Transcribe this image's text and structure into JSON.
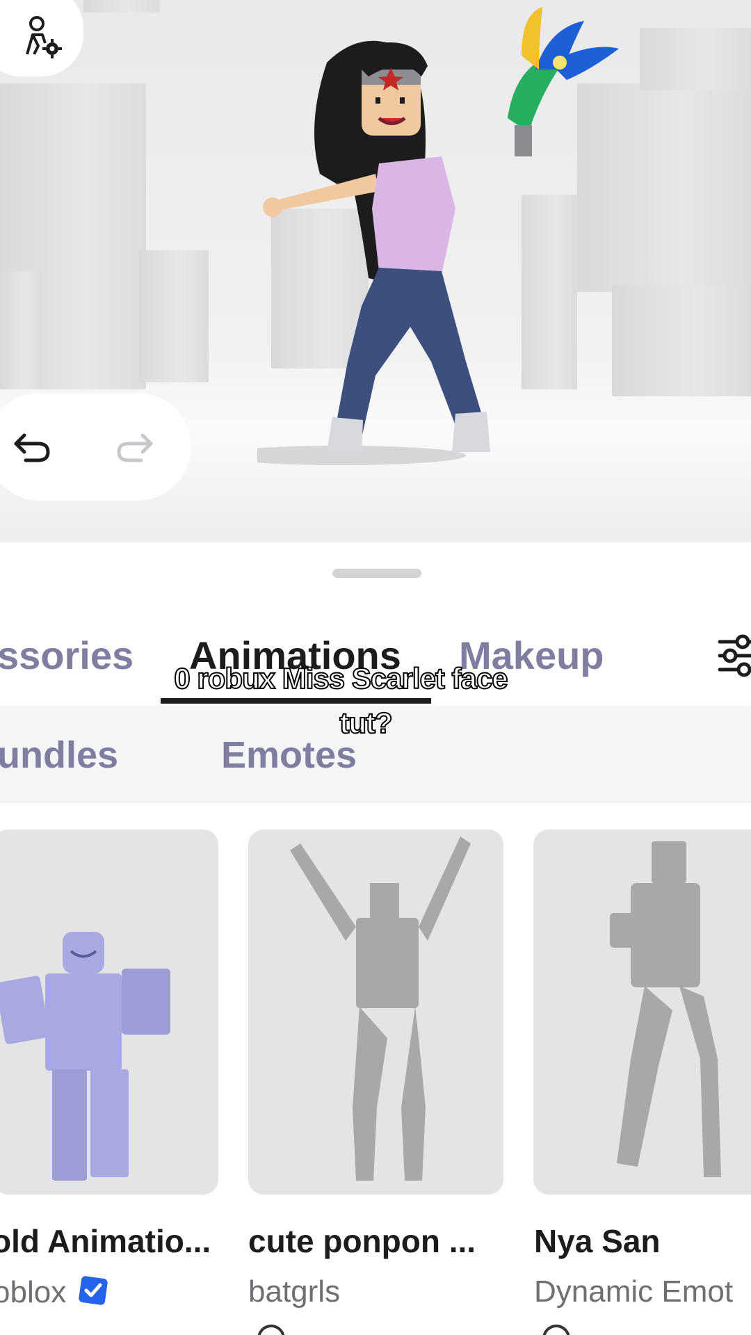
{
  "tabs": {
    "items": [
      {
        "label": "ssories",
        "active": false
      },
      {
        "label": "Animations",
        "active": true
      },
      {
        "label": "Makeup",
        "active": false
      }
    ]
  },
  "subtabs": [
    "undles",
    "Emotes"
  ],
  "caption": {
    "line1": "0 robux Miss Scarlet face",
    "line2": "tut?"
  },
  "items": [
    {
      "name": "old Animatio...",
      "creator": "oblox",
      "verified": true
    },
    {
      "name": "cute ponpon ...",
      "creator": "batgrls",
      "verified": false
    },
    {
      "name": "Nya San",
      "creator": "Dynamic Emot",
      "verified": false
    }
  ],
  "colors": {
    "accent_verified": "#2563eb",
    "inactive_tab": "#7f7ea0",
    "active_tab": "#1c1c1e",
    "avatar_preview": "#a8a9e0"
  },
  "icons": {
    "avatar_settings": "avatar-settings-icon",
    "undo": "undo-icon",
    "redo": "redo-icon",
    "filter": "filter-sliders-icon"
  }
}
